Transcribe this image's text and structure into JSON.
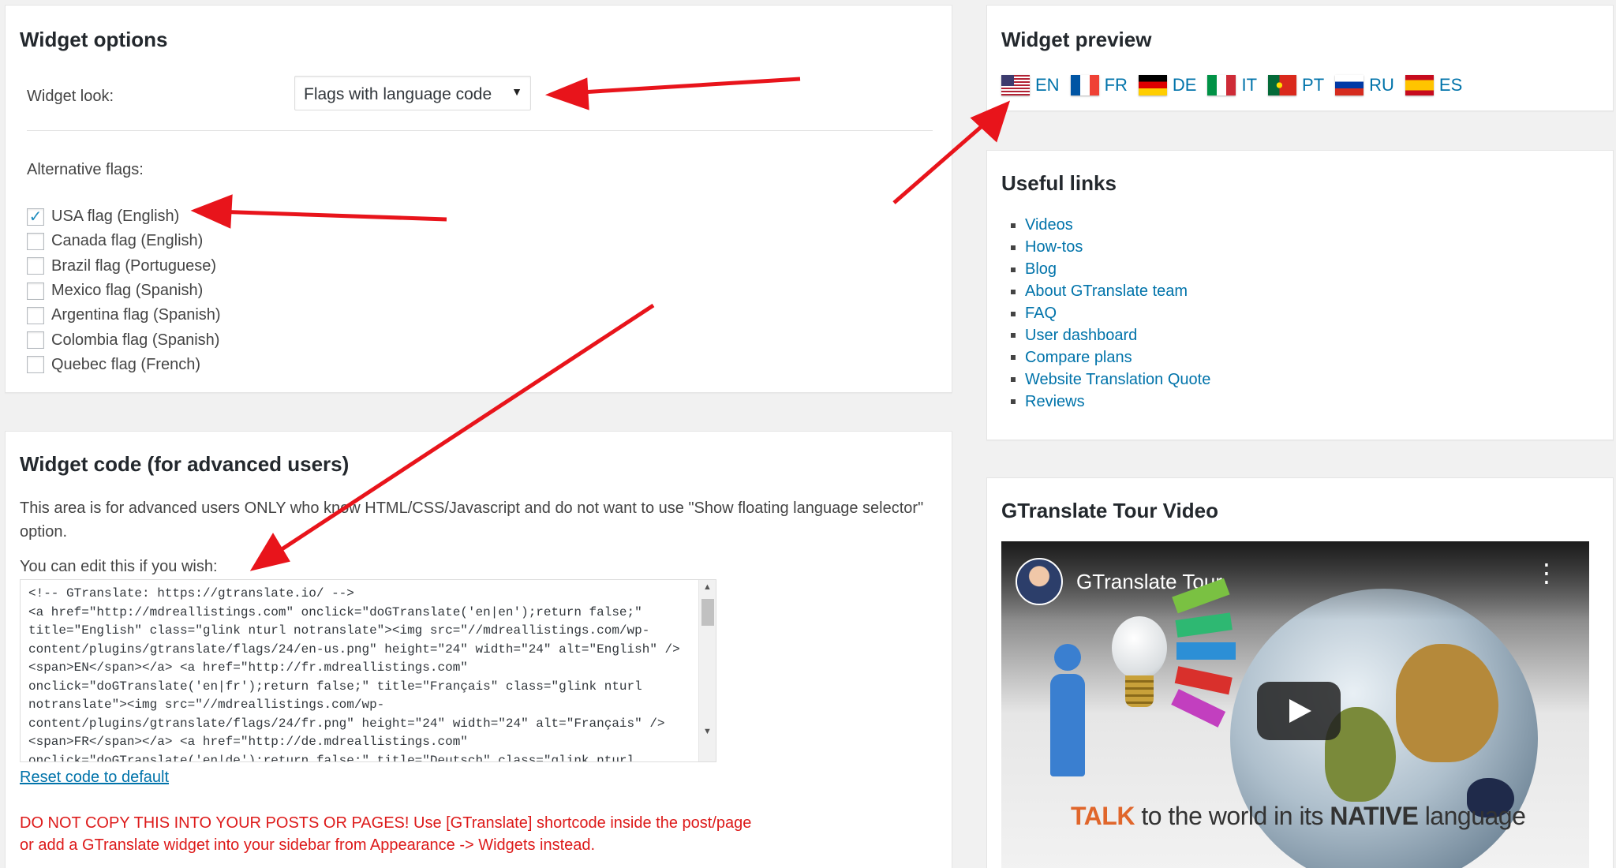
{
  "widget_options": {
    "title": "Widget options",
    "widget_look_label": "Widget look:",
    "widget_look_value": "Flags with language code",
    "alt_flags_label": "Alternative flags:",
    "alt_flags": [
      {
        "label": "USA flag (English)",
        "checked": true
      },
      {
        "label": "Canada flag (English)",
        "checked": false
      },
      {
        "label": "Brazil flag (Portuguese)",
        "checked": false
      },
      {
        "label": "Mexico flag (Spanish)",
        "checked": false
      },
      {
        "label": "Argentina flag (Spanish)",
        "checked": false
      },
      {
        "label": "Colombia flag (Spanish)",
        "checked": false
      },
      {
        "label": "Quebec flag (French)",
        "checked": false
      }
    ]
  },
  "widget_code": {
    "title": "Widget code (for advanced users)",
    "description": "This area is for advanced users ONLY who know HTML/CSS/Javascript and do not want to use \"Show floating language selector\" option.",
    "edit_label": "You can edit this if you wish:",
    "code": "<!-- GTranslate: https://gtranslate.io/ -->\n<a href=\"http://mdreallistings.com\" onclick=\"doGTranslate('en|en');return false;\"\ntitle=\"English\" class=\"glink nturl notranslate\"><img src=\"//mdreallistings.com/wp-\ncontent/plugins/gtranslate/flags/24/en-us.png\" height=\"24\" width=\"24\" alt=\"English\" />\n<span>EN</span></a> <a href=\"http://fr.mdreallistings.com\"\nonclick=\"doGTranslate('en|fr');return false;\" title=\"Français\" class=\"glink nturl\nnotranslate\"><img src=\"//mdreallistings.com/wp-\ncontent/plugins/gtranslate/flags/24/fr.png\" height=\"24\" width=\"24\" alt=\"Français\" />\n<span>FR</span></a> <a href=\"http://de.mdreallistings.com\"\nonclick=\"doGTranslate('en|de');return false;\" title=\"Deutsch\" class=\"glink nturl",
    "reset_link": "Reset code to default",
    "warning": "DO NOT COPY THIS INTO YOUR POSTS OR PAGES! Use [GTranslate] shortcode inside the post/page or add a GTranslate widget into your sidebar from Appearance -> Widgets instead."
  },
  "widget_preview": {
    "title": "Widget preview",
    "languages": [
      {
        "code": "EN",
        "flag": "usa-flag"
      },
      {
        "code": "FR",
        "flag": "france-flag"
      },
      {
        "code": "DE",
        "flag": "germany-flag"
      },
      {
        "code": "IT",
        "flag": "italy-flag"
      },
      {
        "code": "PT",
        "flag": "portugal-flag"
      },
      {
        "code": "RU",
        "flag": "russia-flag"
      },
      {
        "code": "ES",
        "flag": "spain-flag"
      }
    ]
  },
  "useful_links": {
    "title": "Useful links",
    "items": [
      "Videos",
      "How-tos",
      "Blog",
      "About GTranslate team",
      "FAQ",
      "User dashboard",
      "Compare plans",
      "Website Translation Quote",
      "Reviews"
    ]
  },
  "video": {
    "section_title": "GTranslate Tour Video",
    "video_title": "GTranslate Tour",
    "tagline_1": "TALK",
    "tagline_2": " to the world in its ",
    "tagline_3": "NATIVE",
    "tagline_4": " language"
  },
  "colors": {
    "link": "#0073aa",
    "warning": "#dd1a1a",
    "annotation_arrow": "#e8141b"
  }
}
